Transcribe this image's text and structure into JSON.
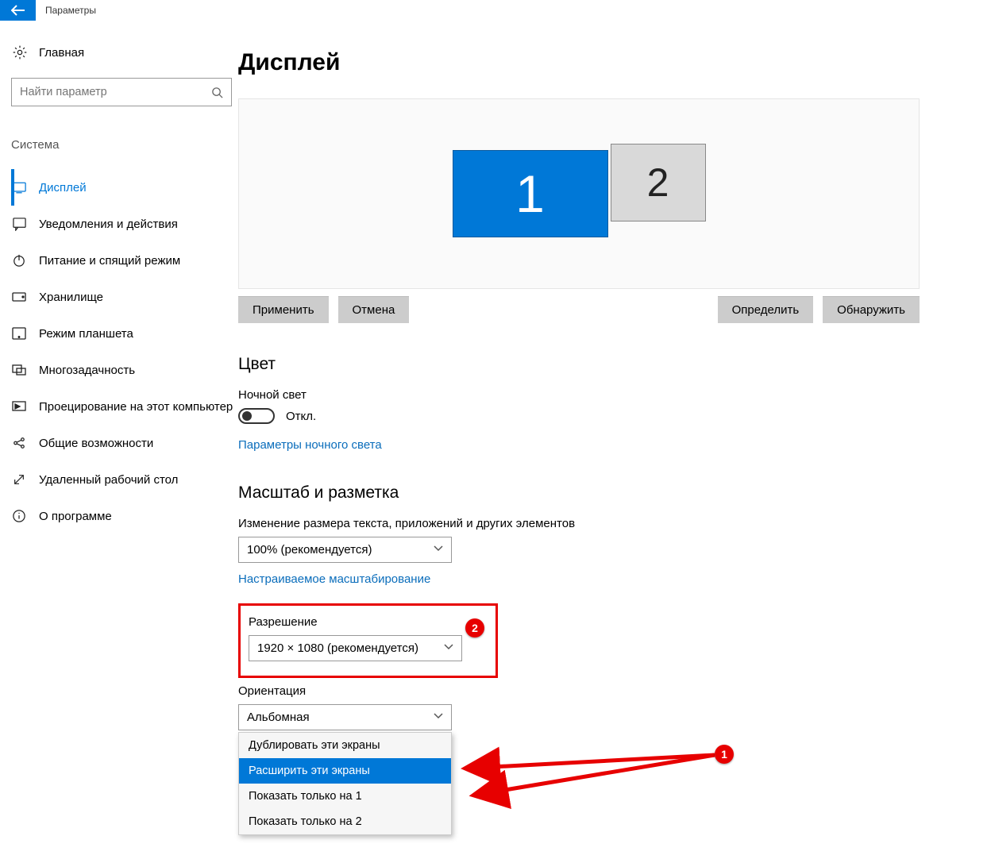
{
  "titlebar": {
    "app_title": "Параметры"
  },
  "sidebar": {
    "home": "Главная",
    "search_placeholder": "Найти параметр",
    "section": "Система",
    "items": [
      {
        "label": "Дисплей",
        "active": true
      },
      {
        "label": "Уведомления и действия"
      },
      {
        "label": "Питание и спящий режим"
      },
      {
        "label": "Хранилище"
      },
      {
        "label": "Режим планшета"
      },
      {
        "label": "Многозадачность"
      },
      {
        "label": "Проецирование на этот компьютер"
      },
      {
        "label": "Общие возможности"
      },
      {
        "label": "Удаленный рабочий стол"
      },
      {
        "label": "О программе"
      }
    ]
  },
  "main": {
    "page_title": "Дисплей",
    "monitors": {
      "primary": "1",
      "secondary": "2"
    },
    "buttons": {
      "apply": "Применить",
      "cancel": "Отмена",
      "identify": "Определить",
      "detect": "Обнаружить"
    },
    "color": {
      "title": "Цвет",
      "nightlight_label": "Ночной свет",
      "nightlight_state": "Откл.",
      "nightlight_link": "Параметры ночного света"
    },
    "scale": {
      "title": "Масштаб и разметка",
      "textscale_label": "Изменение размера текста, приложений и других элементов",
      "textscale_value": "100% (рекомендуется)",
      "scaling_link": "Настраиваемое масштабирование",
      "resolution_label": "Разрешение",
      "resolution_value": "1920 × 1080 (рекомендуется)",
      "orientation_label": "Ориентация",
      "orientation_value": "Альбомная"
    },
    "multidisplay_options": [
      "Дублировать эти экраны",
      "Расширить эти экраны",
      "Показать только на 1",
      "Показать только на 2"
    ],
    "annotations": {
      "badge1": "1",
      "badge2": "2"
    }
  }
}
